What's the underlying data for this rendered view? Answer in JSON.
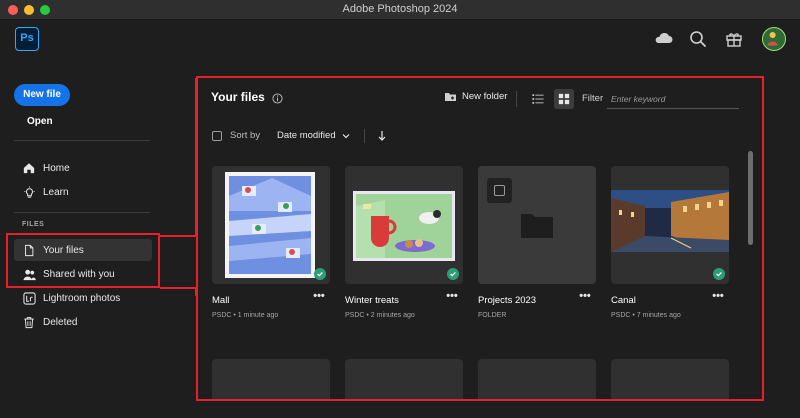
{
  "window": {
    "title": "Adobe Photoshop 2024"
  },
  "app": {
    "logo_text": "Ps"
  },
  "header_icons": [
    "cloud-icon",
    "search-icon",
    "gift-icon",
    "avatar"
  ],
  "sidebar": {
    "new_file_label": "New file",
    "open_label": "Open",
    "nav": [
      {
        "label": "Home",
        "icon": "home-icon"
      },
      {
        "label": "Learn",
        "icon": "lightbulb-icon"
      }
    ],
    "files_section_label": "FILES",
    "files_nav": [
      {
        "label": "Your files",
        "icon": "file-icon",
        "active": true
      },
      {
        "label": "Shared with you",
        "icon": "shared-users-icon",
        "active": false
      },
      {
        "label": "Lightroom photos",
        "icon": "lightroom-icon",
        "active": false
      },
      {
        "label": "Deleted",
        "icon": "trash-icon",
        "active": false
      }
    ]
  },
  "main": {
    "title": "Your files",
    "new_folder_label": "New folder",
    "filter_label": "Filter",
    "filter_placeholder": "Enter keyword",
    "sort_by_label": "Sort by",
    "sort_value": "Date modified",
    "files": [
      {
        "name": "Mall",
        "meta": "PSDC • 1 minute ago",
        "synced": true,
        "kind": "image"
      },
      {
        "name": "Winter treats",
        "meta": "PSDC • 2 minutes ago",
        "synced": true,
        "kind": "image"
      },
      {
        "name": "Projects 2023",
        "meta": "FOLDER",
        "synced": false,
        "kind": "folder"
      },
      {
        "name": "Canal",
        "meta": "PSDC • 7 minutes ago",
        "synced": true,
        "kind": "image"
      }
    ]
  },
  "colors": {
    "accent": "#1473e6",
    "highlight_border": "#e8202a",
    "sync_green": "#2d9d78",
    "background": "#1e1e1e"
  }
}
